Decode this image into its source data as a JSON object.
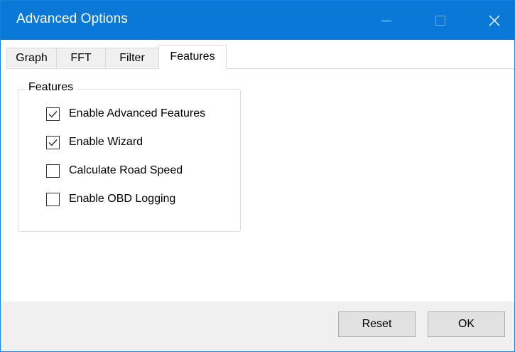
{
  "window": {
    "title": "Advanced Options",
    "accent_color": "#0a78d7",
    "controls": {
      "minimize_icon": "minimize-icon",
      "maximize_icon": "maximize-icon",
      "close_icon": "close-icon"
    }
  },
  "tabs": [
    {
      "label": "Graph",
      "selected": false
    },
    {
      "label": "FFT",
      "selected": false
    },
    {
      "label": "Filter",
      "selected": false
    },
    {
      "label": "Features",
      "selected": true
    }
  ],
  "features_group": {
    "label": "Features",
    "options": [
      {
        "label": "Enable Advanced Features",
        "checked": true
      },
      {
        "label": "Enable Wizard",
        "checked": true
      },
      {
        "label": "Calculate Road Speed",
        "checked": false
      },
      {
        "label": "Enable OBD Logging",
        "checked": false
      }
    ]
  },
  "buttons": {
    "reset_label": "Reset",
    "ok_label": "OK"
  }
}
